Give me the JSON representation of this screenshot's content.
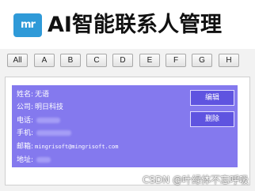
{
  "header": {
    "logo_text": "mr",
    "title": "AI智能联系人管理"
  },
  "letter_filter": [
    "All",
    "A",
    "B",
    "C",
    "D",
    "E",
    "F",
    "G",
    "H"
  ],
  "contact": {
    "name_label": "姓名:",
    "name_value": "无语",
    "company_label": "公司:",
    "company_value": "明日科技",
    "phone_label": "电话:",
    "mobile_label": "手机:",
    "email_label": "邮箱:",
    "email_value": "mingrisoft@mingrisoft.com",
    "address_label": "地址:",
    "edit_label": "编辑",
    "delete_label": "删除"
  },
  "watermark": "CSDN @叶绿体不忘呼吸",
  "colors": {
    "card": "#8479ee",
    "logo": "#2f9ad8",
    "button": "#5f54e0"
  }
}
